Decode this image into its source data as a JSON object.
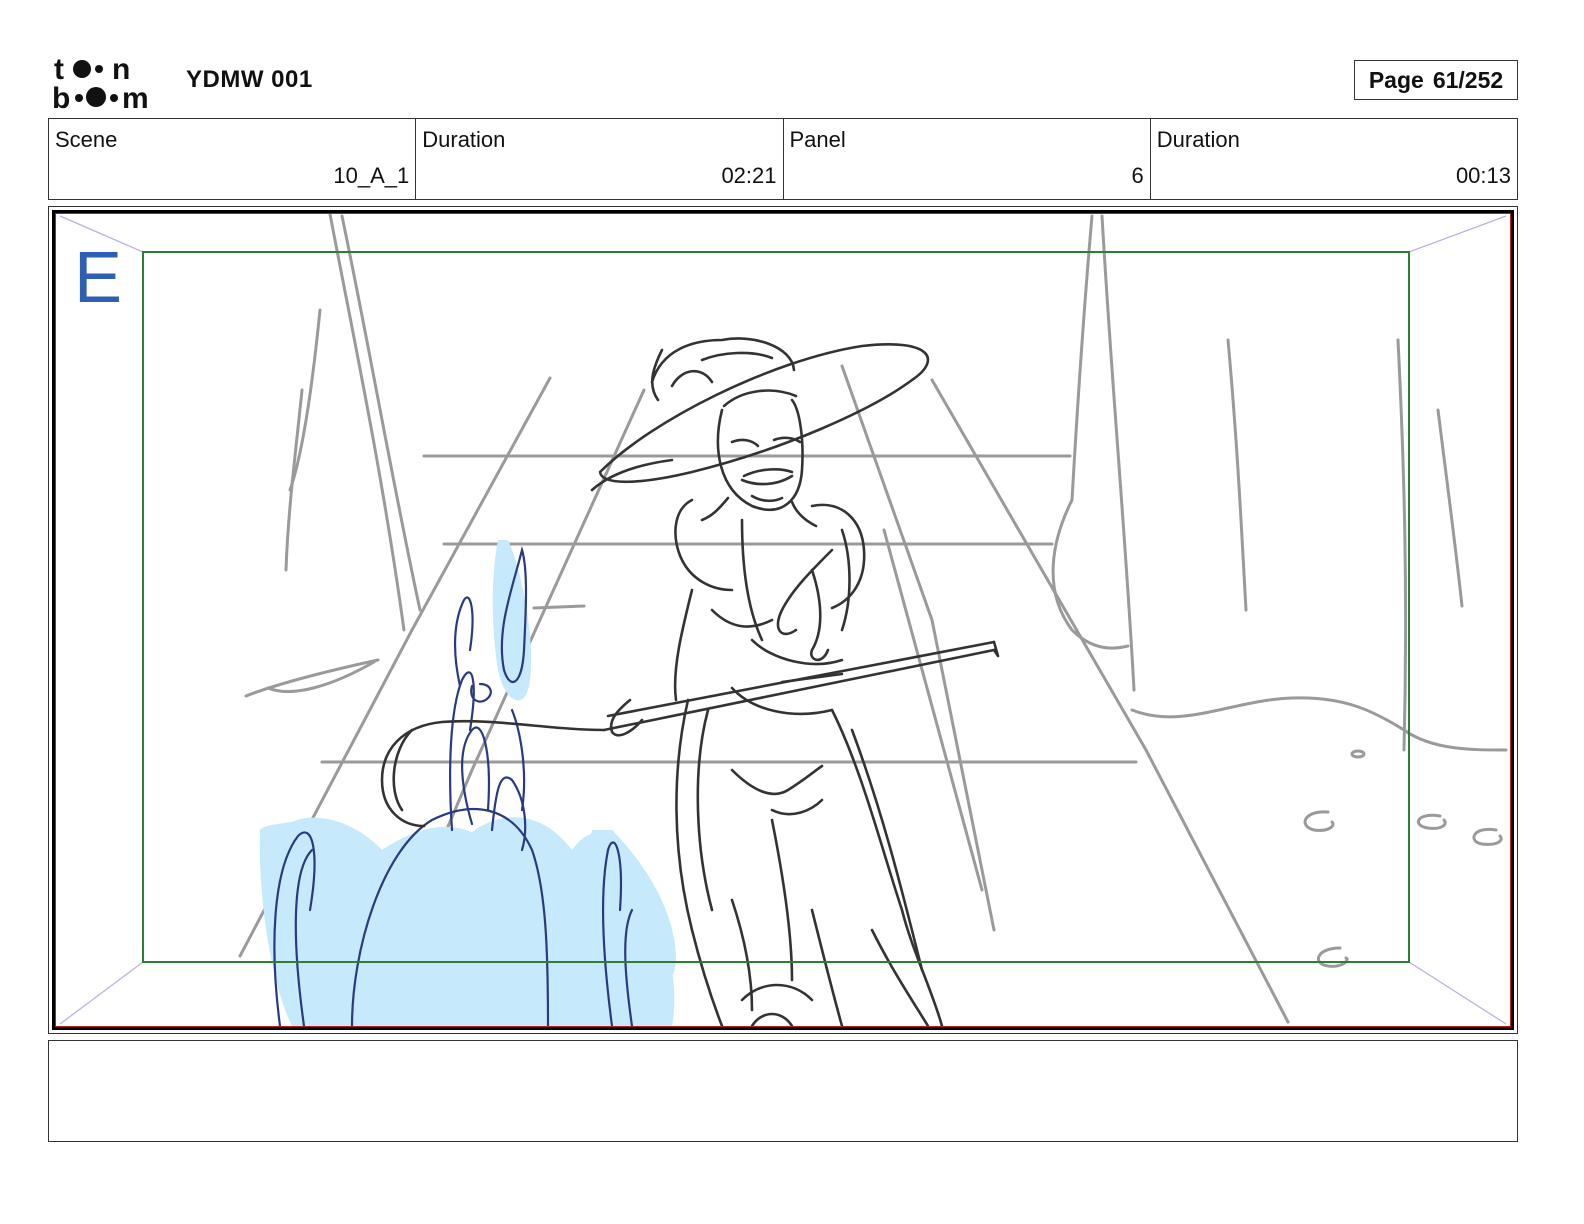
{
  "header": {
    "logo_text": "toonboom",
    "project_title": "YDMW 001",
    "page_label": "Page",
    "page_value": "61/252"
  },
  "info": {
    "scene_label": "Scene",
    "scene_value": "10_A_1",
    "scene_duration_label": "Duration",
    "scene_duration_value": "02:21",
    "panel_label": "Panel",
    "panel_value": "6",
    "panel_duration_label": "Duration",
    "panel_duration_value": "00:13"
  },
  "panel": {
    "layer_marker": "E",
    "colors": {
      "outer_border": "#000000",
      "inner_border": "#c41a1a",
      "safe_frame": "#2e7d32",
      "marker": "#2d5fb5",
      "sketch_lines": "#333333",
      "background_lines": "#9a9a9a",
      "blue_sketch": "#2a3a80",
      "blue_fill": "#c6e9fb"
    }
  },
  "notes": {
    "text": ""
  }
}
